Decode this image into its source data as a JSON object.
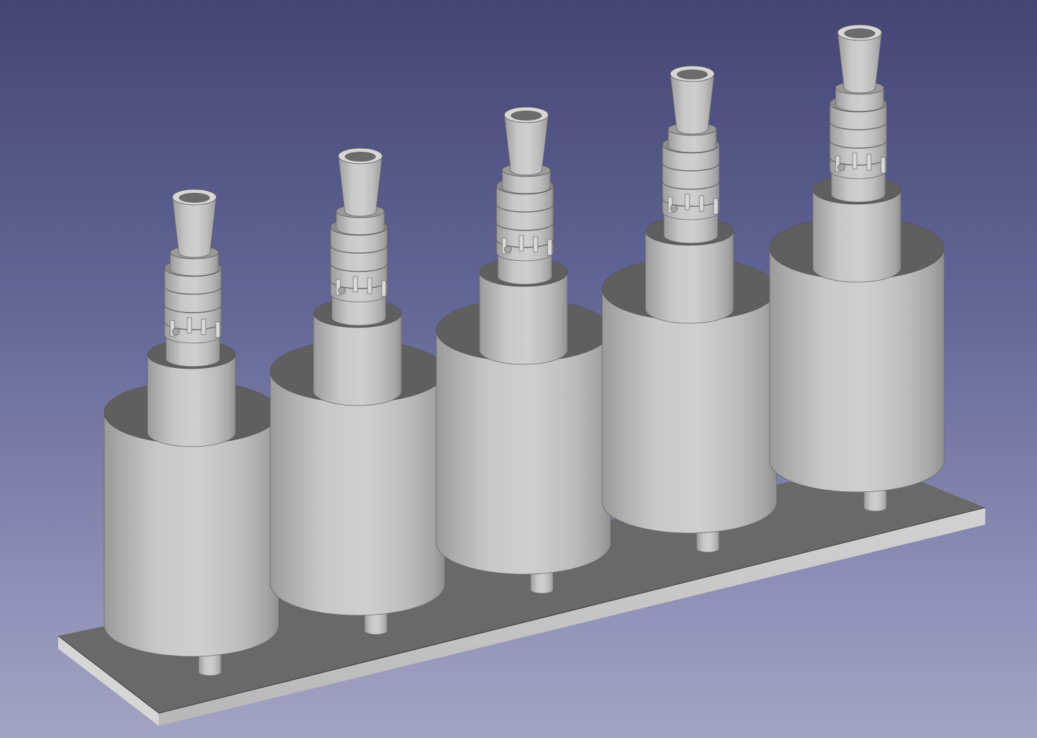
{
  "viewport": {
    "background_top": "#444575",
    "background_bottom": "#a3a3c2",
    "view_mode": "axonometric",
    "shading": "shaded"
  },
  "model": {
    "base_plate": {
      "color_top": "#696969",
      "color_front": "#c9c9c9"
    },
    "towers": [
      {
        "index": 1
      },
      {
        "index": 2
      },
      {
        "index": 3
      },
      {
        "index": 4
      },
      {
        "index": 5
      }
    ],
    "body_color": "#bdbdbd",
    "top_face_color": "#5f5f5f"
  }
}
